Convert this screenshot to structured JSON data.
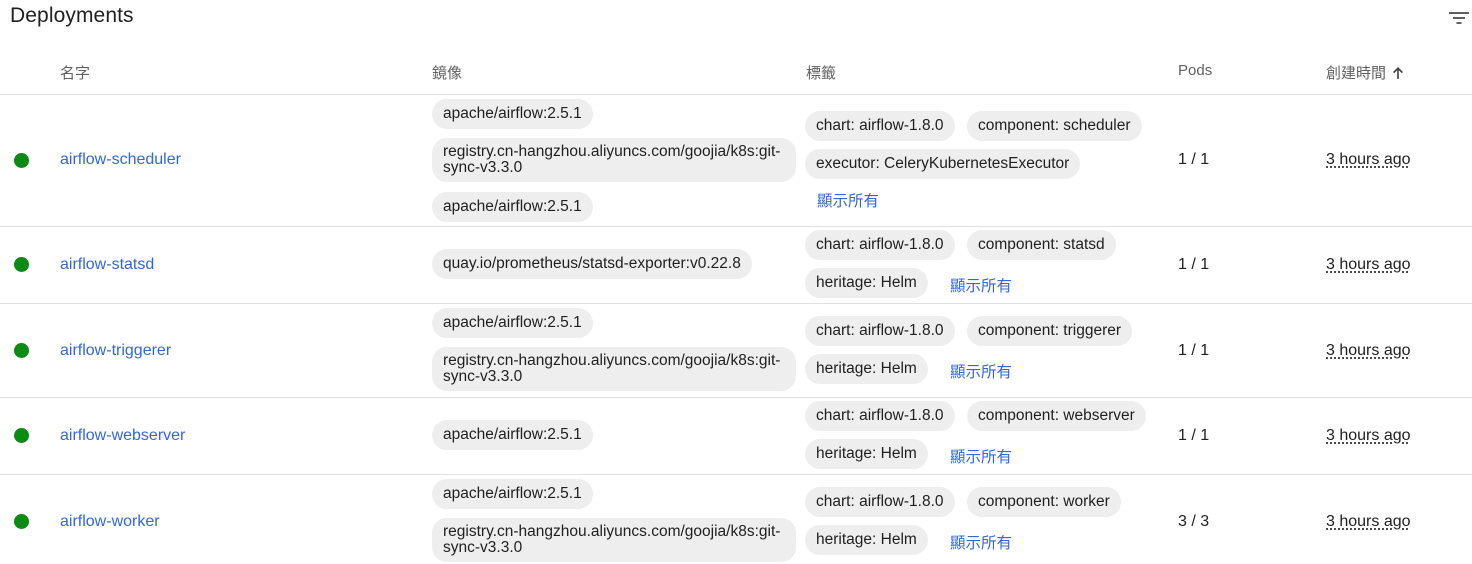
{
  "header": {
    "title": "Deployments",
    "filter_icon": "filter-list-icon"
  },
  "columns": {
    "name": "名字",
    "image": "鏡像",
    "labels": "標籤",
    "pods": "Pods",
    "created": "創建時間",
    "sort_icon": "arrow-upward-icon"
  },
  "colors": {
    "status_ok": "#0b8a14",
    "link": "#3367d6",
    "chip_bg": "#eeeeee"
  },
  "rows": [
    {
      "status": "running",
      "name": "airflow-scheduler",
      "images": [
        "apache/airflow:2.5.1",
        "registry.cn-hangzhou.aliyuncs.com/goojia/k8s:git-sync-v3.3.0",
        "apache/airflow:2.5.1"
      ],
      "labels": [
        "chart: airflow-1.8.0",
        "component: scheduler",
        "executor: CeleryKubernetesExecutor"
      ],
      "show_all": "顯示所有",
      "pods": "1 / 1",
      "created": "3 hours ago"
    },
    {
      "status": "running",
      "name": "airflow-statsd",
      "images": [
        "quay.io/prometheus/statsd-exporter:v0.22.8"
      ],
      "labels": [
        "chart: airflow-1.8.0",
        "component: statsd",
        "heritage: Helm"
      ],
      "show_all": "顯示所有",
      "pods": "1 / 1",
      "created": "3 hours ago"
    },
    {
      "status": "running",
      "name": "airflow-triggerer",
      "images": [
        "apache/airflow:2.5.1",
        "registry.cn-hangzhou.aliyuncs.com/goojia/k8s:git-sync-v3.3.0"
      ],
      "labels": [
        "chart: airflow-1.8.0",
        "component: triggerer",
        "heritage: Helm"
      ],
      "show_all": "顯示所有",
      "pods": "1 / 1",
      "created": "3 hours ago"
    },
    {
      "status": "running",
      "name": "airflow-webserver",
      "images": [
        "apache/airflow:2.5.1"
      ],
      "labels": [
        "chart: airflow-1.8.0",
        "component: webserver",
        "heritage: Helm"
      ],
      "show_all": "顯示所有",
      "pods": "1 / 1",
      "created": "3 hours ago"
    },
    {
      "status": "running",
      "name": "airflow-worker",
      "images": [
        "apache/airflow:2.5.1",
        "registry.cn-hangzhou.aliyuncs.com/goojia/k8s:git-sync-v3.3.0"
      ],
      "labels": [
        "chart: airflow-1.8.0",
        "component: worker",
        "heritage: Helm"
      ],
      "show_all": "顯示所有",
      "pods": "3 / 3",
      "created": "3 hours ago"
    }
  ]
}
